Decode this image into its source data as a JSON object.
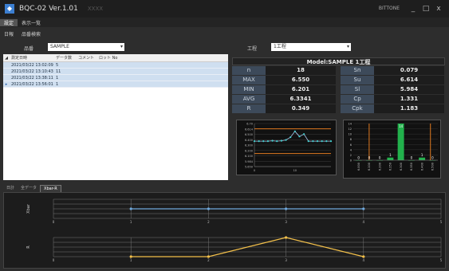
{
  "window": {
    "title": "BQC-02 Ver.1.01",
    "ghost_text": "XXXX",
    "user": "BITTONE",
    "controls": [
      "_",
      "□",
      "x"
    ]
  },
  "menu": {
    "items": [
      "設定",
      "表示一覧"
    ]
  },
  "tabs": {
    "items": [
      "日報",
      "品番検索"
    ]
  },
  "filters": {
    "item_label": "品番",
    "item_value": "SAMPLE",
    "process_label": "工程",
    "process_value": "1工程"
  },
  "table": {
    "headers": [
      "測定日時",
      "データ数",
      "コメント",
      "ロット No"
    ],
    "rows": [
      [
        "2021/03/22 13:02:09",
        "5",
        "",
        ""
      ],
      [
        "2021/03/22 13:10:43",
        "11",
        "",
        ""
      ],
      [
        "2021/03/22 13:38:11",
        "1",
        "",
        ""
      ],
      [
        "2021/03/22 13:56:01",
        "1",
        "",
        ""
      ]
    ]
  },
  "stats": {
    "model_title": "Model:SAMPLE   1工程",
    "rows": [
      {
        "k1": "n",
        "v1": "18",
        "k2": "Sn",
        "v2": "0.079"
      },
      {
        "k1": "MAX",
        "v1": "6.550",
        "k2": "Su",
        "v2": "6.614"
      },
      {
        "k1": "MIN",
        "v1": "6.201",
        "k2": "Sl",
        "v2": "5.984"
      },
      {
        "k1": "AVG",
        "v1": "6.3341",
        "k2": "Cp",
        "v2": "1.331"
      },
      {
        "k1": "R",
        "v1": "0.349",
        "k2": "Cpk",
        "v2": "1.183"
      }
    ]
  },
  "bottom_tabs": {
    "items": [
      "日計",
      "全データ",
      "Xbar-R"
    ]
  },
  "colors": {
    "xbar_line": "#6fa8dc",
    "r_line": "#f3c04a",
    "hist_bar": "#22b14c",
    "spec_line": "#e07a20"
  },
  "chart_data": [
    {
      "type": "line",
      "name": "trend",
      "x": [
        1,
        2,
        3,
        4,
        5,
        6,
        7,
        8,
        9,
        10,
        11,
        12,
        13,
        14,
        15,
        16,
        17,
        18
      ],
      "values": [
        6.3,
        6.3,
        6.3,
        6.3,
        6.31,
        6.3,
        6.31,
        6.33,
        6.4,
        6.55,
        6.42,
        6.48,
        6.3,
        6.3,
        6.3,
        6.3,
        6.3,
        6.3
      ],
      "ylim": [
        5.65,
        6.75
      ],
      "y_ticks": [
        "6.70",
        "6.614",
        "6.500",
        "6.400",
        "6.300",
        "6.200",
        "6.100",
        "5.984",
        "5.650"
      ],
      "x_ticks": [
        "0",
        "10"
      ],
      "spec_lines": [
        6.614,
        5.984
      ]
    },
    {
      "type": "bar",
      "name": "histogram",
      "categories": [
        "6.000",
        "6.100",
        "6.200",
        "6.250",
        "6.300",
        "6.350",
        "6.400",
        "6.500"
      ],
      "values": [
        0,
        0,
        0,
        1,
        14,
        0,
        1,
        0
      ],
      "data_labels": [
        "0",
        "0",
        "0",
        "1",
        "14",
        "0",
        "1",
        "0"
      ],
      "ylim": [
        0,
        14
      ],
      "y_ticks": [
        "14",
        "12",
        "10",
        "8",
        "6",
        "4",
        "2",
        "0"
      ]
    },
    {
      "type": "line",
      "name": "Xbar",
      "ylabel": "Xbar",
      "x": [
        1,
        2,
        3,
        4
      ],
      "values": [
        6.31,
        6.31,
        6.31,
        6.31
      ],
      "x_ticks": [
        "0",
        "1",
        "2",
        "3",
        "4",
        "5"
      ],
      "grid": true
    },
    {
      "type": "line",
      "name": "R",
      "ylabel": "R",
      "x": [
        1,
        2,
        3,
        4
      ],
      "values": [
        0.0,
        0.0,
        0.35,
        0.0
      ],
      "ylim": [
        0,
        0.35
      ],
      "x_ticks": [
        "0",
        "1",
        "2",
        "3",
        "4",
        "5"
      ],
      "grid": true
    }
  ]
}
